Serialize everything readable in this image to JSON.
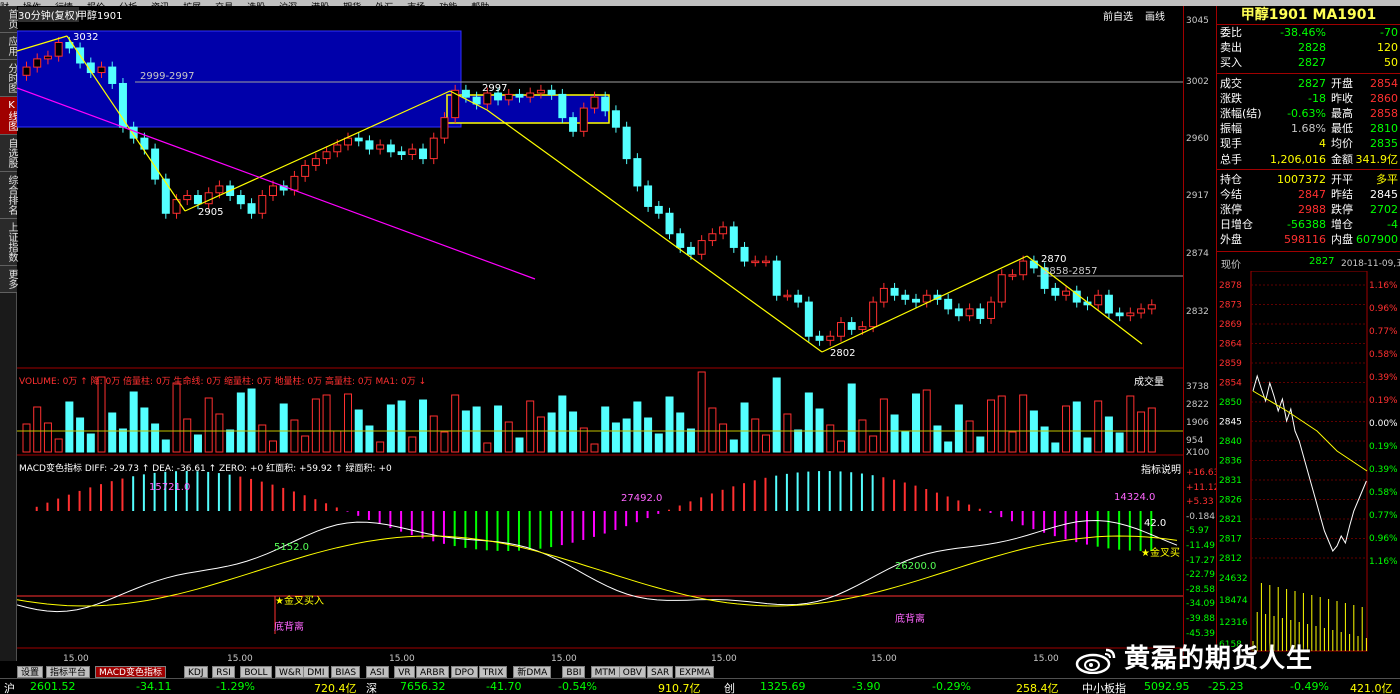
{
  "topmenu": [
    "财",
    "操作",
    "行情",
    "报价",
    "分析",
    "资讯",
    "扩展",
    "交易",
    "选股",
    "沪深",
    "港股",
    "期货",
    "外汇",
    "市场",
    "功能",
    "帮助"
  ],
  "leftnav": [
    {
      "label": "首页",
      "active": false
    },
    {
      "label": "应用",
      "active": false
    },
    {
      "label": "分时图",
      "active": false
    },
    {
      "label": "K线图",
      "active": true
    },
    {
      "label": "自选股",
      "active": false
    },
    {
      "label": "综合排名",
      "active": false
    },
    {
      "label": "上证指数",
      "active": false
    },
    {
      "label": "更多",
      "active": false
    }
  ],
  "chart": {
    "period_label": "30分钟(复权)",
    "symbol_label": "甲醇1901",
    "toolbar_right": [
      "前自选",
      "画线"
    ],
    "price_annotations": {
      "high1": "3032",
      "range1": "2999-2997",
      "low1": "2905",
      "high2": "2997",
      "low2": "2802",
      "high3": "2870",
      "range2": "2858-2857"
    },
    "volume_legend": "VOLUME: 0万 ↑ 降: 0万 倍量柱: 0万 生命线: 0万 缩量柱: 0万 地量柱: 0万 高量柱: 0万 MA1: 0万 ↓",
    "volume_btn": "成交量",
    "macd_legend": "MACD变色指标 DIFF: -29.73 ↑ DEA: -36.61 ↑ ZERO: +0 红面积: +59.92 ↑ 绿面积: +0",
    "macd_btn": "指标说明",
    "macd_values": {
      "a": "15721.0",
      "b": "5152.0",
      "c": "27492.0",
      "d": "26200.0",
      "e": "14324.0",
      "f": "42.0"
    },
    "signals": {
      "buy": "金叉买入",
      "div1": "底背离",
      "div2": "底背离",
      "cross": "金叉买"
    },
    "xaxis_labels": [
      "15.00",
      "15.00",
      "15.00",
      "15.00",
      "15.00",
      "15.00",
      "15.00"
    ],
    "colors": {
      "up": "#ff3030",
      "down": "#54ffff",
      "box": "#0000aa",
      "trend": "#ffff00",
      "magenta": "#ff00ff"
    }
  },
  "axis_main": [
    "3045",
    "3002",
    "2960",
    "2917",
    "2874",
    "2832"
  ],
  "axis_volume": [
    "3738",
    "2822",
    "1906",
    "954",
    "X100"
  ],
  "axis_macd": [
    "+16.63",
    "+11.12",
    "+5.33",
    "-0.184",
    "-5.97",
    "-11.49",
    "-17.27",
    "-22.79",
    "-28.58",
    "-34.09",
    "-39.88",
    "-45.39"
  ],
  "panel": {
    "title": "甲醇1901 MA1901",
    "quotes": [
      {
        "l": "委比",
        "v": "-38.46%",
        "vc": "#00ff00",
        "r": "",
        "rv": "-70",
        "rc": "#00ff00"
      },
      {
        "l": "卖出",
        "v": "2828",
        "vc": "#00ff00",
        "r": "",
        "rv": "120",
        "rc": "#ffff00"
      },
      {
        "l": "买入",
        "v": "2827",
        "vc": "#00ff00",
        "r": "",
        "rv": "50",
        "rc": "#ffff00"
      },
      {
        "l": "成交",
        "v": "2827",
        "vc": "#00ff00",
        "r": "开盘",
        "rv": "2854",
        "rc": "#ff3030"
      },
      {
        "l": "涨跌",
        "v": "-18",
        "vc": "#00ff00",
        "r": "昨收",
        "rv": "2860",
        "rc": "#ff3030"
      },
      {
        "l": "涨幅(结)",
        "v": "-0.63%",
        "vc": "#00ff00",
        "r": "最高",
        "rv": "2858",
        "rc": "#ff3030"
      },
      {
        "l": "振幅",
        "v": "1.68%",
        "vc": "#c8c8c8",
        "r": "最低",
        "rv": "2810",
        "rc": "#00ff00"
      },
      {
        "l": "现手",
        "v": "4",
        "vc": "#ffff00",
        "r": "均价",
        "rv": "2835",
        "rc": "#00ff00"
      },
      {
        "l": "总手",
        "v": "1,206,016",
        "vc": "#ffff00",
        "r": "金额",
        "rv": "341.9亿",
        "rc": "#ffff00"
      },
      {
        "l": "持仓",
        "v": "1007372",
        "vc": "#ffff00",
        "r": "开平",
        "rv": "多平",
        "rc": "#ffff00"
      },
      {
        "l": "今结",
        "v": "2847",
        "vc": "#ff3030",
        "r": "昨结",
        "rv": "2845",
        "rc": "#ffffff"
      },
      {
        "l": "涨停",
        "v": "2988",
        "vc": "#ff3030",
        "r": "跌停",
        "rv": "2702",
        "rc": "#00ff00"
      },
      {
        "l": "日增仓",
        "v": "-56388",
        "vc": "#00ff00",
        "r": "增仓",
        "rv": "-4",
        "rc": "#00ff00"
      },
      {
        "l": "外盘",
        "v": "598116",
        "vc": "#ff3030",
        "r": "内盘",
        "rv": "607900",
        "rc": "#00ff00"
      }
    ],
    "timeline_label": "现价",
    "timeline_price": "2827",
    "timeline_date": "2018-11-09,五",
    "mini_axis_left": [
      "2878",
      "2873",
      "2869",
      "2864",
      "2859",
      "2854",
      "2850",
      "2845",
      "2840",
      "2836",
      "2831",
      "2826",
      "2821",
      "2817",
      "2812",
      "24632",
      "18474",
      "12316",
      "6158"
    ],
    "mini_axis_right": [
      "1.16%",
      "0.96%",
      "0.77%",
      "0.58%",
      "0.39%",
      "0.19%",
      "0.00%",
      "0.19%",
      "0.39%",
      "0.58%",
      "0.77%",
      "0.96%",
      "1.16%"
    ]
  },
  "tabs": [
    {
      "label": "设置",
      "active": false
    },
    {
      "label": "指标平台",
      "active": false
    },
    {
      "label": "MACD变色指标",
      "active": true
    },
    {
      "label": "KDJ",
      "active": false
    },
    {
      "label": "RSI",
      "active": false
    },
    {
      "label": "BOLL",
      "active": false
    },
    {
      "label": "W&R",
      "active": false
    },
    {
      "label": "DMI",
      "active": false
    },
    {
      "label": "BIAS",
      "active": false
    },
    {
      "label": "ASI",
      "active": false
    },
    {
      "label": "VR",
      "active": false
    },
    {
      "label": "ARBR",
      "active": false
    },
    {
      "label": "DPO",
      "active": false
    },
    {
      "label": "TRIX",
      "active": false
    },
    {
      "label": "新DMA",
      "active": false
    },
    {
      "label": "BBI",
      "active": false
    },
    {
      "label": "MTM",
      "active": false
    },
    {
      "label": "OBV",
      "active": false
    },
    {
      "label": "SAR",
      "active": false
    },
    {
      "label": "EXPMA",
      "active": false
    }
  ],
  "status": {
    "sh_label": "沪",
    "sh_val": "2601.52",
    "sh_chg": "-34.11",
    "sh_pct": "-1.29%",
    "sh_amt": "720.4亿",
    "sz_label": "深",
    "sz_val": "7656.32",
    "sz_chg": "-41.70",
    "sz_pct": "-0.54%",
    "sz_amt": "910.7亿",
    "cy_label": "创",
    "cy_val": "1325.69",
    "cy_chg": "-3.90",
    "cy_pct": "-0.29%",
    "cy_amt": "258.4亿",
    "zx_label": "中小板指",
    "zx_val": "5092.95",
    "zx_chg": "-25.23",
    "zx_pct": "-0.49%",
    "zx_amt": "421.0亿"
  },
  "watermark": "黄磊的期货人生"
}
